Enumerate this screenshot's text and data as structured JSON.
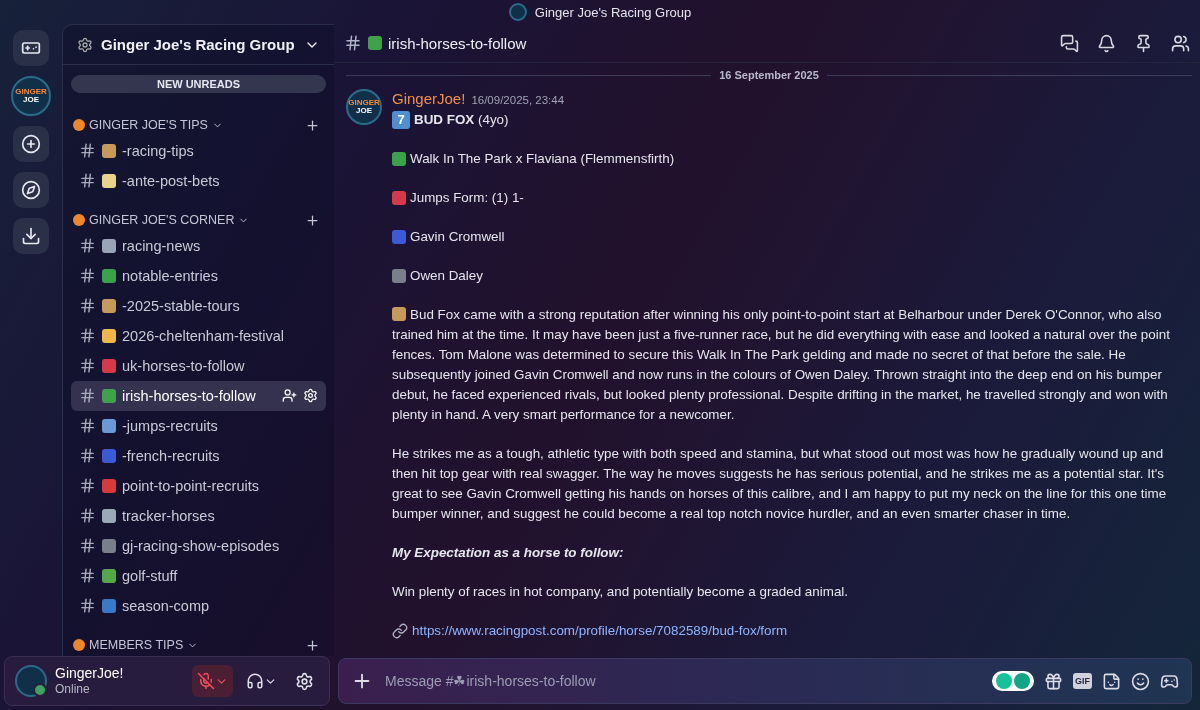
{
  "titlebar": {
    "title": "Ginger Joe's Racing Group"
  },
  "rail": [
    {
      "kind": "home"
    },
    {
      "kind": "server",
      "logo_text": [
        "GINGER",
        "JOE"
      ]
    },
    {
      "kind": "add"
    },
    {
      "kind": "discover"
    },
    {
      "kind": "download"
    }
  ],
  "sidebar": {
    "server_name": "Ginger Joe's Racing Group",
    "unreads_pill": "NEW UNREADS",
    "categories": [
      {
        "name": "GINGER JOE'S TIPS",
        "expanded": true,
        "channels": [
          {
            "name": "-racing-tips",
            "selected": false
          },
          {
            "name": "-ante-post-bets",
            "selected": false
          }
        ]
      },
      {
        "name": "GINGER JOE'S CORNER",
        "expanded": true,
        "channels": [
          {
            "name": "racing-news",
            "selected": false
          },
          {
            "name": "notable-entries",
            "selected": false
          },
          {
            "name": "-2025-stable-tours",
            "selected": false
          },
          {
            "name": "2026-cheltenham-festival",
            "selected": false
          },
          {
            "name": "uk-horses-to-follow",
            "selected": false
          },
          {
            "name": "irish-horses-to-follow",
            "selected": true
          },
          {
            "name": "-jumps-recruits",
            "selected": false
          },
          {
            "name": "-french-recruits",
            "selected": false
          },
          {
            "name": "point-to-point-recruits",
            "selected": false
          },
          {
            "name": "tracker-horses",
            "selected": false
          },
          {
            "name": "gj-racing-show-episodes",
            "selected": false
          },
          {
            "name": "golf-stuff",
            "selected": false
          },
          {
            "name": "season-comp",
            "selected": false
          }
        ]
      },
      {
        "name": "MEMBERS TIPS",
        "expanded": true
      }
    ]
  },
  "user_panel": {
    "name": "GingerJoe!",
    "status": "Online",
    "muted": true
  },
  "header": {
    "channel": "irish-horses-to-follow"
  },
  "date_divider": "16 September 2025",
  "message": {
    "author": "GingerJoe!",
    "timestamp": "16/09/2025, 23:44",
    "logo_text": [
      "GINGER",
      "JOE"
    ],
    "lines": [
      {
        "kind": "title",
        "badge": "7",
        "text": "**BUD FOX** (4yo)"
      },
      {
        "kind": "icon-line",
        "text": "Walk In The Park x Flaviana (Flemmensfirth)"
      },
      {
        "kind": "icon-line",
        "text": "Jumps Form: (1) 1-"
      },
      {
        "kind": "icon-line",
        "text": "Gavin Cromwell"
      },
      {
        "kind": "icon-line",
        "text": "Owen Daley"
      },
      {
        "kind": "icon-paragraph",
        "text": "Bud Fox came with a strong reputation after winning his only point-to-point start at Belharbour under Derek O'Connor, who also trained him at the time. It may have been just a five-runner race, but he did everything with ease and looked a natural over the point fences. Tom Malone was determined to secure this Walk In The Park gelding and made no secret of that before the sale. He subsequently joined Gavin Cromwell and now runs in the colours of Owen Daley. Thrown straight into the deep end on his bumper debut, he faced experienced rivals, but looked plenty professional. Despite drifting in the market, he travelled strongly and won with plenty in hand. A very smart performance for a newcomer."
      },
      {
        "kind": "paragraph",
        "text": "He strikes me as a tough, athletic type with both speed and stamina, but what stood out most was how he gradually wound up and then hit top gear with real swagger. The way he moves suggests he has serious potential, and he strikes me as a potential star. It's great to see Gavin Cromwell getting his hands on horses of this calibre, and I am happy to put my neck on the line for this one time bumper winner, and suggest he could become a real top notch novice hurdler, and an even smarter chaser in time."
      },
      {
        "kind": "heading",
        "text": "My Expectation as a horse to follow:"
      },
      {
        "kind": "paragraph",
        "text": "Win plenty of races in hot company, and potentially become a graded animal."
      },
      {
        "kind": "link",
        "text": "https://www.racingpost.com/profile/horse/7082589/bud-fox/form"
      }
    ]
  },
  "composer": {
    "placeholder": "Message #☘irish-horses-to-follow",
    "gif_label": "GIF"
  }
}
